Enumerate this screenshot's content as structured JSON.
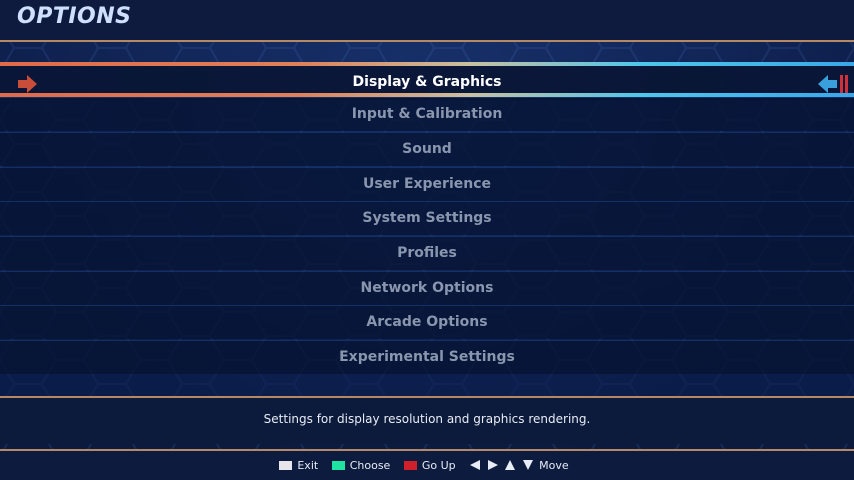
{
  "screen": {
    "title": "OPTIONS"
  },
  "menu": {
    "selected_index": 0,
    "items": [
      {
        "label": "Display & Graphics"
      },
      {
        "label": "Input & Calibration"
      },
      {
        "label": "Sound"
      },
      {
        "label": "User Experience"
      },
      {
        "label": "System Settings"
      },
      {
        "label": "Profiles"
      },
      {
        "label": "Network Options"
      },
      {
        "label": "Arcade Options"
      },
      {
        "label": "Experimental Settings"
      }
    ]
  },
  "description": {
    "text": "Settings for display resolution and graphics rendering."
  },
  "help": {
    "exit_label": "Exit",
    "choose_label": "Choose",
    "goup_label": "Go Up",
    "move_label": "Move"
  },
  "colors": {
    "exit_swatch": "#e6e6ea",
    "choose_swatch": "#1fe3a0",
    "goup_swatch": "#d0202a",
    "left_arrow": "#c94e3a",
    "right_arrow": "#3aa0dc",
    "accent_line": "#b38a63"
  },
  "icons": {
    "left": "arrow-right-icon",
    "right": "arrow-left-icon",
    "dpad": [
      "triangle-left-icon",
      "triangle-right-icon",
      "triangle-up-icon",
      "triangle-down-icon"
    ]
  }
}
